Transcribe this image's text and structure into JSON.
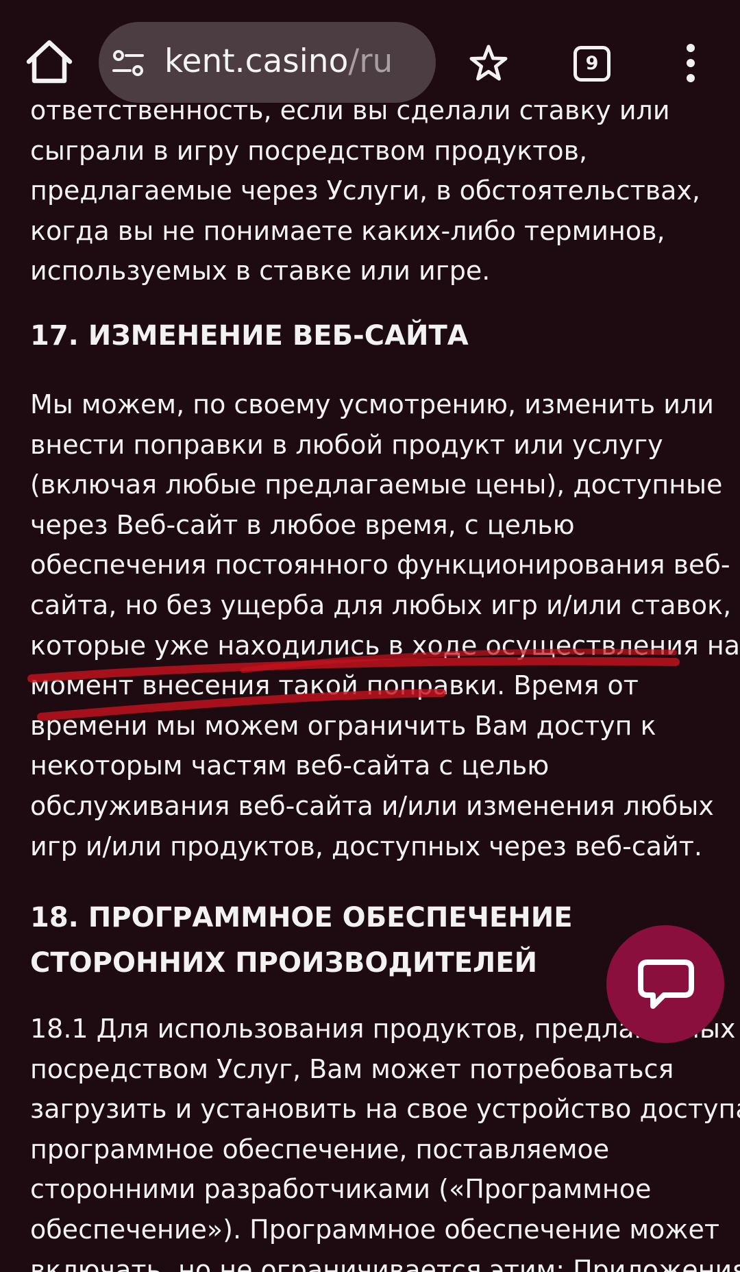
{
  "toolbar": {
    "url_host": "kent.casino",
    "url_path": "/ru",
    "tab_count": "9",
    "icons": {
      "home": "home-icon",
      "site_settings": "tune-icon",
      "bookmark": "star-icon",
      "tabs": "tabs-counter-icon",
      "menu": "more-vert-icon"
    }
  },
  "article": {
    "intro_lines": [
      "ответственность, если вы сделали ставку или",
      "сыграли в игру посредством продуктов,",
      "предлагаемые через Услуги, в обстоятельствах,",
      "когда вы не понимаете каких-либо терминов,",
      "используемых в ставке или игре."
    ],
    "section17": {
      "heading": "17. ИЗМЕНЕНИЕ ВЕБ-САЙТА",
      "lines": [
        "Мы можем, по своему усмотрению, изменить или",
        "внести поправки в любой продукт или услугу",
        "(включая любые предлагаемые цены), доступные",
        "через Веб-сайт в любое время, с целью",
        "обеспечения постоянного функционирования веб-",
        "сайта, но без ущерба для любых игр и/или ставок,",
        "которые уже находились в ходе осуществления на",
        "момент внесения такой поправки. Время от",
        "времени мы можем ограничить Вам доступ к",
        "некоторым частям веб-сайта с целью",
        "обслуживания веб-сайта и/или изменения любых",
        "игр и/или продуктов, доступных через веб-сайт."
      ]
    },
    "section18": {
      "heading_lines": [
        "18. ПРОГРАММНОЕ ОБЕСПЕЧЕНИЕ",
        "СТОРОННИХ ПРОИЗВОДИТЕЛЕЙ"
      ],
      "lines": [
        "18.1 Для использования продуктов, предлагаемых",
        "посредством Услуг, Вам может потребоваться",
        "загрузить и установить на свое устройство доступа",
        "программное обеспечение, поставляемое",
        "сторонними разработчиками («Программное",
        "обеспечение»). Программное обеспечение может",
        "включать, но не ограничивается этим: Приложения"
      ]
    }
  },
  "annotation": {
    "color": "#c4121d"
  },
  "chat_button": {
    "icon": "chat-bubble-icon",
    "color": "#8a0f3c"
  }
}
